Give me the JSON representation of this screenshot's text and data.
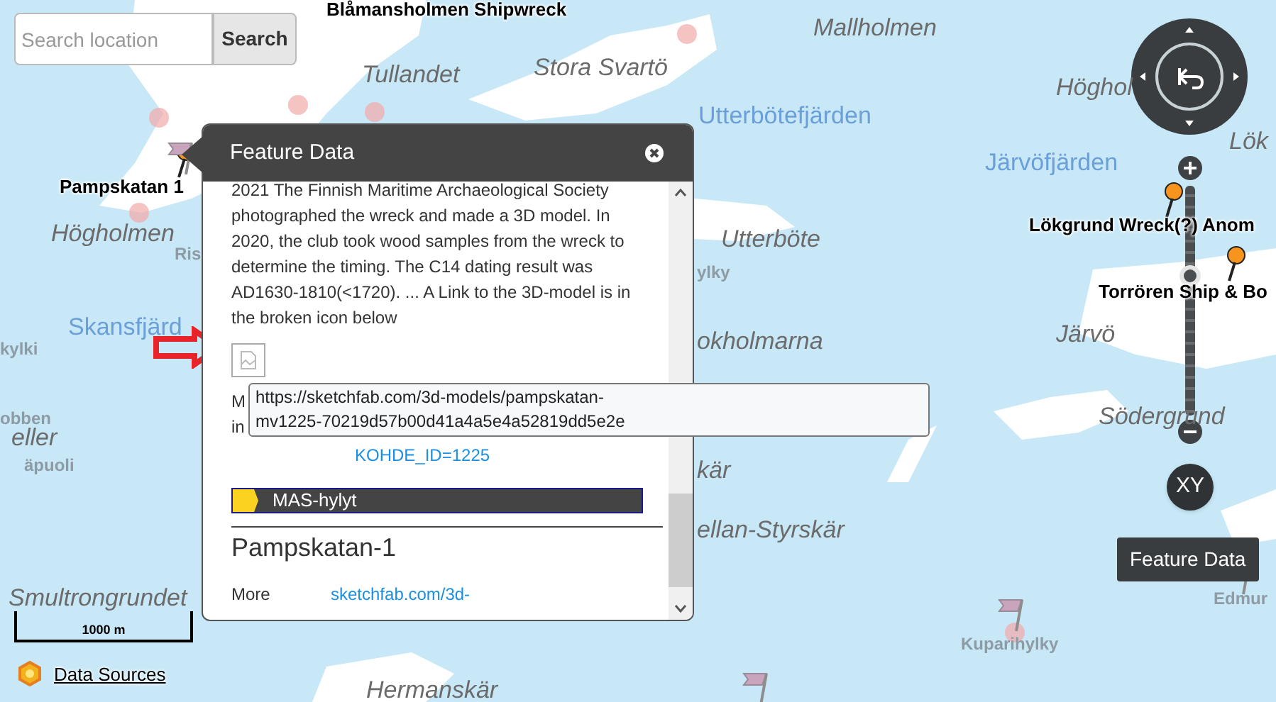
{
  "search": {
    "placeholder": "Search location",
    "button": "Search"
  },
  "map_labels": [
    {
      "text": "Blåmansholmen Shipwreck",
      "kind": "marker"
    },
    {
      "text": "Tullandet",
      "kind": "place"
    },
    {
      "text": "Stora Svartö",
      "kind": "place"
    },
    {
      "text": "Mallholmen",
      "kind": "place"
    },
    {
      "text": "Utterbötefjärden",
      "kind": "water"
    },
    {
      "text": "Höghol",
      "kind": "place"
    },
    {
      "text": "Lök",
      "kind": "place"
    },
    {
      "text": "Järvöfjärden",
      "kind": "water"
    },
    {
      "text": "Lökgrund Wreck(?) Anom",
      "kind": "marker"
    },
    {
      "text": "Utterböte",
      "kind": "place"
    },
    {
      "text": "ylky",
      "kind": "faded"
    },
    {
      "text": "Torrören Ship & Bo",
      "kind": "marker"
    },
    {
      "text": "okholmarna",
      "kind": "place"
    },
    {
      "text": "Järvö",
      "kind": "place"
    },
    {
      "text": "Södergrund",
      "kind": "place"
    },
    {
      "text": "kär",
      "kind": "place"
    },
    {
      "text": "ellan-Styrskär",
      "kind": "place"
    },
    {
      "text": "Pampskatan 1",
      "kind": "marker"
    },
    {
      "text": "Högholmen",
      "kind": "place"
    },
    {
      "text": "Ris",
      "kind": "faded"
    },
    {
      "text": "Skansfjärd",
      "kind": "water"
    },
    {
      "text": "kylki",
      "kind": "faded"
    },
    {
      "text": "obben",
      "kind": "faded"
    },
    {
      "text": "eller",
      "kind": "place"
    },
    {
      "text": "äpuoli",
      "kind": "faded"
    },
    {
      "text": "Smultrongrundet",
      "kind": "place"
    },
    {
      "text": "Kuparihylky",
      "kind": "faded"
    },
    {
      "text": "Edmur",
      "kind": "faded"
    },
    {
      "text": "Hermanskär",
      "kind": "place"
    }
  ],
  "zoom_slider": {
    "level": 0.62
  },
  "xy_button": "XY",
  "feature_tooltip": "Feature Data",
  "scale_bar": "1000 m",
  "data_sources": "Data Sources",
  "popup": {
    "title": "Feature Data",
    "description": "2021 The Finnish Maritime Archaeological Society photographed the wreck and made a 3D model. In 2020, the club took wood samples from the wreck to determine the timing. The C14 dating result was AD1630-1810(<1720). ... A Link to the 3D-model is in the broken icon below",
    "covered_lines": [
      "M",
      "in"
    ],
    "link": "KOHDE_ID=1225",
    "layer": "MAS-hylyt",
    "heading": "Pampskatan-1",
    "more_label": "More",
    "more_link": "sketchfab.com/3d-",
    "link_tooltip": [
      "https://sketchfab.com/3d-models/pampskatan-",
      "mv1225-70219d57b00d41a4a5e4a52819dd5e2e"
    ]
  }
}
